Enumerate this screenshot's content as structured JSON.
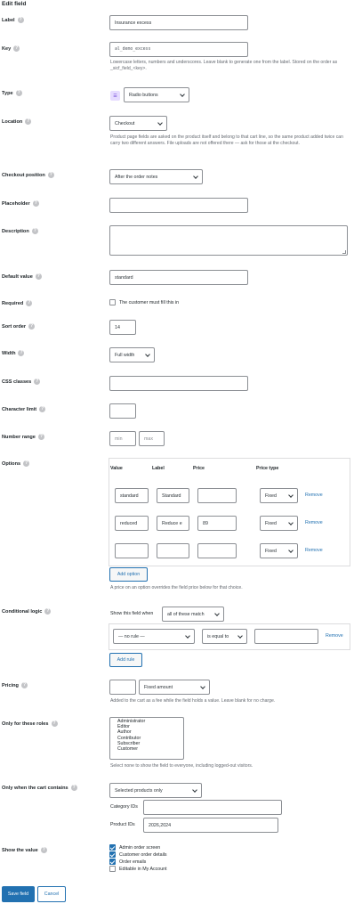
{
  "page_title": "Edit field",
  "label": {
    "text": "Label",
    "value": "Insurance excess"
  },
  "key": {
    "text": "Key",
    "value": "al_demo_excess",
    "help": "Lowercase letters, numbers and underscores. Leave blank to generate one from the label. Stored on the order as _sicf_field_<key>."
  },
  "type": {
    "text": "Type",
    "value": "Radio buttons",
    "icon": "list-icon"
  },
  "location": {
    "text": "Location",
    "value": "Checkout",
    "help": "Product page fields are asked on the product itself and belong to that cart line, so the same product added twice can carry two different answers. File uploads are not offered there — ask for those at the checkout."
  },
  "checkout_position": {
    "text": "Checkout position",
    "value": "After the order notes"
  },
  "placeholder": {
    "text": "Placeholder",
    "value": ""
  },
  "description": {
    "text": "Description",
    "value": ""
  },
  "default_value": {
    "text": "Default value",
    "value": "standard"
  },
  "required": {
    "text": "Required",
    "checkbox_label": "The customer must fill this in",
    "checked": false
  },
  "sort_order": {
    "text": "Sort order",
    "value": "14"
  },
  "width": {
    "text": "Width",
    "value": "Full width"
  },
  "css_classes": {
    "text": "CSS classes",
    "value": ""
  },
  "character_limit": {
    "text": "Character limit",
    "value": ""
  },
  "number_range": {
    "text": "Number range",
    "min_placeholder": "min",
    "max_placeholder": "max"
  },
  "options": {
    "text": "Options",
    "headers": {
      "value": "Value",
      "label": "Label",
      "price": "Price",
      "price_type": "Price type"
    },
    "rows": [
      {
        "value": "standard",
        "label": "Standard",
        "price": "",
        "price_type": "Fixed",
        "remove": "Remove"
      },
      {
        "value": "reduced",
        "label": "Reduce e",
        "price": "89",
        "price_type": "Fixed",
        "remove": "Remove"
      },
      {
        "value": "",
        "label": "",
        "price": "",
        "price_type": "Fixed",
        "remove": "Remove"
      }
    ],
    "add_label": "Add option",
    "help": "A price on an option overrides the field price below for that choice."
  },
  "conditional_logic": {
    "text": "Conditional logic",
    "prefix": "Show this field when",
    "match": "all of these match",
    "rule_field": "— no rule —",
    "operator": "is equal to",
    "rule_value": "",
    "remove": "Remove",
    "add_rule": "Add rule"
  },
  "pricing": {
    "text": "Pricing",
    "amount": "",
    "mode": "Fixed amount",
    "help": "Added to the cart as a fee while the field holds a value. Leave blank for no charge."
  },
  "roles": {
    "text": "Only for these roles",
    "items": [
      "Administrator",
      "Editor",
      "Author",
      "Contributor",
      "Subscriber",
      "Customer"
    ],
    "help": "Select none to show the field to everyone, including logged-out visitors."
  },
  "cart_contains": {
    "text": "Only when the cart contains",
    "mode": "Selected products only",
    "category_label": "Category IDs",
    "category_value": "",
    "product_label": "Product IDs",
    "product_value": "2026,2024"
  },
  "show_value": {
    "text": "Show the value",
    "items": [
      {
        "label": "Admin order screen",
        "checked": true
      },
      {
        "label": "Customer order details",
        "checked": true
      },
      {
        "label": "Order emails",
        "checked": true
      },
      {
        "label": "Editable in My Account",
        "checked": false
      }
    ]
  },
  "buttons": {
    "save": "Save field",
    "cancel": "Cancel"
  },
  "colors": {
    "accent": "#2271b1",
    "border": "#8c8f94",
    "help": "#c3c4c7"
  }
}
